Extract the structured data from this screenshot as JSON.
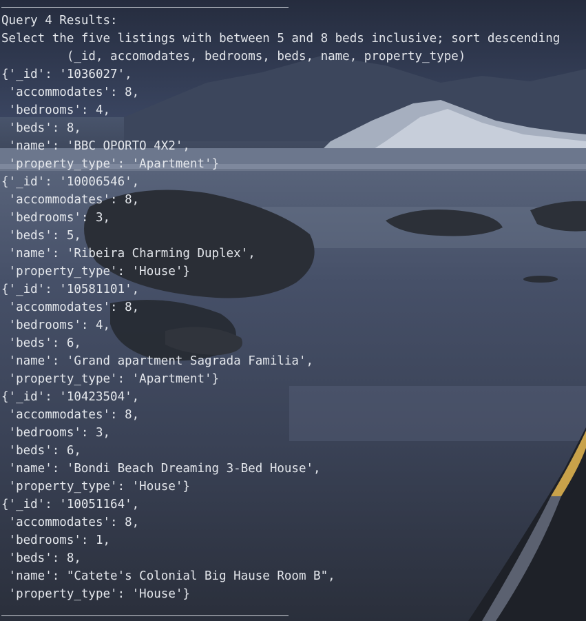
{
  "window": {
    "background_color": "#2e3444",
    "text_color": "#e4e7ec"
  },
  "output": {
    "header": "Query 4 Results:",
    "description": "Select the five listings with between 5 and 8 beds inclusive; sort descending",
    "fields": "         (_id, accomodates, bedrooms, beds, name, property_type)",
    "records": [
      {
        "id": "{'_id': '1036027',",
        "accommodates": " 'accommodates': 8,",
        "bedrooms": " 'bedrooms': 4,",
        "beds": " 'beds': 8,",
        "name": " 'name': 'BBC OPORTO 4X2',",
        "property_type": " 'property_type': 'Apartment'}"
      },
      {
        "id": "{'_id': '10006546',",
        "accommodates": " 'accommodates': 8,",
        "bedrooms": " 'bedrooms': 3,",
        "beds": " 'beds': 5,",
        "name": " 'name': 'Ribeira Charming Duplex',",
        "property_type": " 'property_type': 'House'}"
      },
      {
        "id": "{'_id': '10581101',",
        "accommodates": " 'accommodates': 8,",
        "bedrooms": " 'bedrooms': 4,",
        "beds": " 'beds': 6,",
        "name": " 'name': 'Grand apartment Sagrada Familia',",
        "property_type": " 'property_type': 'Apartment'}"
      },
      {
        "id": "{'_id': '10423504',",
        "accommodates": " 'accommodates': 8,",
        "bedrooms": " 'bedrooms': 3,",
        "beds": " 'beds': 6,",
        "name": " 'name': 'Bondi Beach Dreaming 3-Bed House',",
        "property_type": " 'property_type': 'House'}"
      },
      {
        "id": "{'_id': '10051164',",
        "accommodates": " 'accommodates': 8,",
        "bedrooms": " 'bedrooms': 1,",
        "beds": " 'beds': 8,",
        "name": " 'name': \"Catete's Colonial Big Hause Room B\",",
        "property_type": " 'property_type': 'House'}"
      }
    ]
  }
}
